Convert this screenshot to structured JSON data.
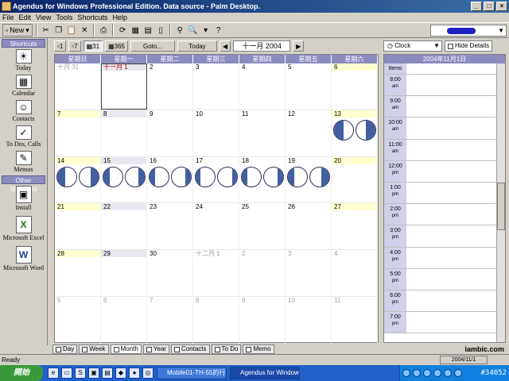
{
  "window": {
    "title": "Agendus for Windows Professional Edition. Data source - Palm Desktop."
  },
  "menu": [
    "File",
    "Edit",
    "View",
    "Tools",
    "Shortcuts",
    "Help"
  ],
  "toolbar": {
    "new_label": "New",
    "user_value": ""
  },
  "sidebar": {
    "shortcuts_header": "Shortcuts",
    "items": [
      {
        "label": "Today",
        "icon": "today-icon"
      },
      {
        "label": "Calendar",
        "icon": "calendar-icon"
      },
      {
        "label": "Contacts",
        "icon": "contacts-icon"
      },
      {
        "label": "To Dos, Calls",
        "icon": "todo-icon"
      },
      {
        "label": "Memos",
        "icon": "memo-icon"
      }
    ],
    "other_header": "Other Shortcuts",
    "other_items": [
      {
        "label": "Install",
        "icon": "install-icon"
      },
      {
        "label": "Microsoft Excel",
        "icon": "excel-icon"
      },
      {
        "label": "Microsoft Word",
        "icon": "word-icon"
      }
    ]
  },
  "calnav": {
    "views": [
      "1",
      "7",
      "31",
      "365"
    ],
    "goto": "Goto...",
    "today": "Today",
    "month": "十一月 2004"
  },
  "calendar": {
    "weekdays": [
      "星期日",
      "星期一",
      "星期二",
      "星期三",
      "星期四",
      "星期五",
      "星期六"
    ],
    "weeks": [
      [
        "十月 31",
        "十一月 1",
        "2",
        "3",
        "4",
        "5",
        "6"
      ],
      [
        "7",
        "8",
        "9",
        "10",
        "11",
        "12",
        "13"
      ],
      [
        "14",
        "15",
        "16",
        "17",
        "18",
        "19",
        "20"
      ],
      [
        "21",
        "22",
        "23",
        "24",
        "25",
        "26",
        "27"
      ],
      [
        "28",
        "29",
        "30",
        "十二月 1",
        "2",
        "3",
        "4"
      ],
      [
        "5",
        "6",
        "7",
        "8",
        "9",
        "10",
        "11"
      ]
    ]
  },
  "bottom_tabs": [
    "Day",
    "Week",
    "Month",
    "Year",
    "Contacts",
    "To Do",
    "Memo"
  ],
  "brand": "iambic.com",
  "dayview": {
    "mode": "Clock",
    "hide_details": "Hide Details",
    "date_title": "2004年11月1日",
    "items_label": "Items",
    "hours": [
      {
        "h": "8:00",
        "ap": "am"
      },
      {
        "h": "9:00",
        "ap": "am"
      },
      {
        "h": "10:00",
        "ap": "am"
      },
      {
        "h": "11:00",
        "ap": "am"
      },
      {
        "h": "12:00",
        "ap": "pm"
      },
      {
        "h": "1:00",
        "ap": "pm"
      },
      {
        "h": "2:00",
        "ap": "pm"
      },
      {
        "h": "3:00",
        "ap": "pm"
      },
      {
        "h": "4:00",
        "ap": "pm"
      },
      {
        "h": "5:00",
        "ap": "pm"
      },
      {
        "h": "6:00",
        "ap": "pm"
      },
      {
        "h": "7:00",
        "ap": "pm"
      }
    ]
  },
  "status": {
    "text": "Ready",
    "date": "2004/11/1"
  },
  "taskbar": {
    "start": "開始",
    "tasks": [
      "Mobile01-TH-55的行...",
      "Agendus for Windows..."
    ],
    "clock": "#34052"
  }
}
